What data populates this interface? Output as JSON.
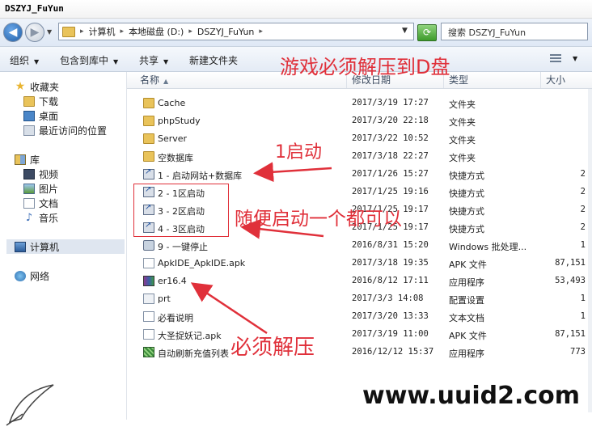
{
  "window": {
    "title": "DSZYJ_FuYun"
  },
  "address": {
    "crumbs": [
      "计算机",
      "本地磁盘 (D:)",
      "DSZYJ_FuYun"
    ],
    "search_placeholder": "搜索 DSZYJ_FuYun"
  },
  "toolbar": {
    "organize": "组织",
    "include_library": "包含到库中",
    "share": "共享",
    "new_folder": "新建文件夹"
  },
  "sidebar": {
    "favorites": "收藏夹",
    "downloads": "下载",
    "desktop": "桌面",
    "recent": "最近访问的位置",
    "libraries": "库",
    "videos": "视频",
    "pictures": "图片",
    "documents": "文档",
    "music": "音乐",
    "computer": "计算机",
    "network": "网络"
  },
  "columns": {
    "name": "名称",
    "date": "修改日期",
    "type": "类型",
    "size": "大小"
  },
  "files": [
    {
      "name": "Cache",
      "date": "2017/3/19 17:27",
      "type": "文件夹",
      "size": "",
      "icon": "folder"
    },
    {
      "name": "phpStudy",
      "date": "2017/3/20 22:18",
      "type": "文件夹",
      "size": "",
      "icon": "folder"
    },
    {
      "name": "Server",
      "date": "2017/3/22 10:52",
      "type": "文件夹",
      "size": "",
      "icon": "folder"
    },
    {
      "name": "空数据库",
      "date": "2017/3/18 22:27",
      "type": "文件夹",
      "size": "",
      "icon": "folder"
    },
    {
      "name": "1 - 启动网站+数据库",
      "date": "2017/1/26 15:27",
      "type": "快捷方式",
      "size": "2",
      "icon": "shortcut"
    },
    {
      "name": "2 - 1区启动",
      "date": "2017/1/25 19:16",
      "type": "快捷方式",
      "size": "2",
      "icon": "shortcut"
    },
    {
      "name": "3 - 2区启动",
      "date": "2017/1/25 19:17",
      "type": "快捷方式",
      "size": "2",
      "icon": "shortcut"
    },
    {
      "name": "4 - 3区启动",
      "date": "2017/1/25 19:17",
      "type": "快捷方式",
      "size": "2",
      "icon": "shortcut"
    },
    {
      "name": "9 - 一键停止",
      "date": "2016/8/31 15:20",
      "type": "Windows 批处理...",
      "size": "1",
      "icon": "batch"
    },
    {
      "name": "ApkIDE_ApkIDE.apk",
      "date": "2017/3/18 19:35",
      "type": "APK 文件",
      "size": "87,151",
      "icon": "apk"
    },
    {
      "name": "er16.4",
      "date": "2016/8/12 17:11",
      "type": "应用程序",
      "size": "53,493",
      "icon": "rar"
    },
    {
      "name": "prt",
      "date": "2017/3/3 14:08",
      "type": "配置设置",
      "size": "1",
      "icon": "config"
    },
    {
      "name": "必看说明",
      "date": "2017/3/20 13:33",
      "type": "文本文档",
      "size": "1",
      "icon": "text"
    },
    {
      "name": "大圣捉妖记.apk",
      "date": "2017/3/19 11:00",
      "type": "APK 文件",
      "size": "87,151",
      "icon": "apk"
    },
    {
      "name": "自动刷新充值列表",
      "date": "2016/12/12 15:37",
      "type": "应用程序",
      "size": "773",
      "icon": "app"
    }
  ],
  "annotations": {
    "top_note": "游戏必须解压到D盘",
    "start_note": "1启动",
    "any_note": "随便启动一个都可以",
    "unzip_note": "必须解压"
  },
  "watermark": "www.uuid2.com",
  "colors": {
    "annotation": "#e0303a",
    "folder": "#e9c35a"
  }
}
